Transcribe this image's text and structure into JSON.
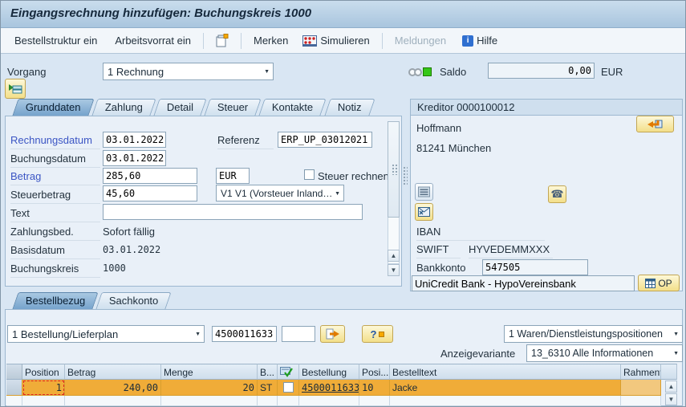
{
  "title_bar": {
    "title": "Eingangsrechnung hinzufügen: Buchungskreis 1000"
  },
  "toolbar": {
    "bestellstruktur": "Bestellstruktur ein",
    "arbeitsvorrat": "Arbeitsvorrat ein",
    "merken": "Merken",
    "simulieren": "Simulieren",
    "meldungen": "Meldungen",
    "hilfe": "Hilfe"
  },
  "header": {
    "vorgang_label": "Vorgang",
    "vorgang_value": "1 Rechnung",
    "saldo_label": "Saldo",
    "saldo_value": "0,00",
    "saldo_currency": "EUR"
  },
  "main_tabs": [
    "Grunddaten",
    "Zahlung",
    "Detail",
    "Steuer",
    "Kontakte",
    "Notiz"
  ],
  "grunddaten": {
    "rechnungsdatum_label": "Rechnungsdatum",
    "rechnungsdatum_value": "03.01.2022",
    "referenz_label": "Referenz",
    "referenz_value": "ERP_UP_03012021",
    "buchungsdatum_label": "Buchungsdatum",
    "buchungsdatum_value": "03.01.2022",
    "betrag_label": "Betrag",
    "betrag_value": "285,60",
    "waehrung_value": "EUR",
    "steuer_rechnen_label": "Steuer rechnen",
    "steuerbetrag_label": "Steuerbetrag",
    "steuerbetrag_value": "45,60",
    "steuerkennzeichen_value": "V1 V1 (Vorsteuer Inland…",
    "text_label": "Text",
    "text_value": "",
    "zahlungsbed_label": "Zahlungsbed.",
    "zahlungsbed_value": "Sofort fällig",
    "basisdatum_label": "Basisdatum",
    "basisdatum_value": "03.01.2022",
    "buchungskreis_label": "Buchungskreis",
    "buchungskreis_value": "1000"
  },
  "kreditor": {
    "header": "Kreditor 0000100012",
    "name": "Hoffmann",
    "city": "81241 München",
    "iban_label": "IBAN",
    "swift_label": "SWIFT",
    "swift_value": "HYVEDEMMXXX",
    "bankkonto_label": "Bankkonto",
    "bankkonto_value": "547505",
    "bank_name": "UniCredit Bank - HypoVereinsbank",
    "op_button": "OP"
  },
  "bottom_tabs": [
    "Bestellbezug",
    "Sachkonto"
  ],
  "bestellbezug": {
    "referenztyp_value": "1 Bestellung/Lieferplan",
    "bestellnummer_value": "4500011633",
    "leerfeld_value": "",
    "positionstyp_value": "1 Waren/Dienstleistungspositionen",
    "anzeigevariante_label": "Anzeigevariante",
    "anzeigevariante_value": "13_6310 Alle Informationen"
  },
  "items_table": {
    "columns": [
      "Position",
      "Betrag",
      "Menge",
      "B...",
      "Bestellung",
      "Posi...",
      "Bestelltext",
      "Rahmenv"
    ],
    "rows": [
      {
        "position": "1",
        "betrag": "240,00",
        "menge": "20",
        "bme": "ST",
        "bestellung": "4500011633",
        "pos": "10",
        "bestelltext": "Jacke",
        "rahmen": ""
      }
    ]
  },
  "icons": {
    "dropdown": "▼",
    "scroll_up": "▲",
    "scroll_down": "▼",
    "phone": "☎"
  },
  "colors": {
    "accent_yellow": "#f3df8a",
    "selected_row": "#f0ac38",
    "status_green": "#35c718",
    "titlebar_blue": "#bad2e8"
  }
}
